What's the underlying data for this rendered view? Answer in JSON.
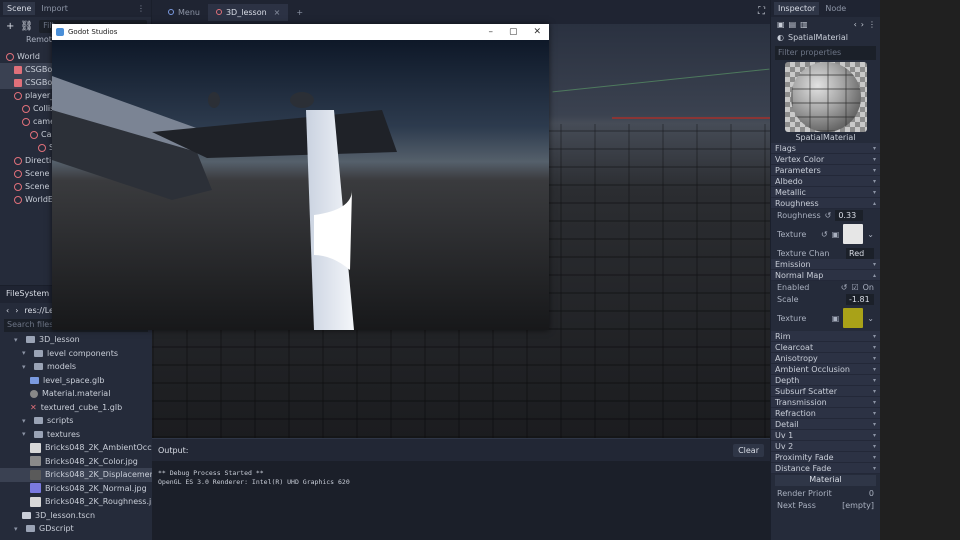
{
  "scene_dock": {
    "tabs": [
      "Scene",
      "Import"
    ],
    "filter_placeholder": "Filt",
    "remote_label": "Remote",
    "tree": [
      {
        "label": "World",
        "indent": 0
      },
      {
        "label": "CSGBox",
        "indent": 1
      },
      {
        "label": "CSGBox",
        "indent": 1
      },
      {
        "label": "player_",
        "indent": 1
      },
      {
        "label": "Collis",
        "indent": 2
      },
      {
        "label": "came",
        "indent": 2
      },
      {
        "label": "Cas",
        "indent": 3
      },
      {
        "label": "S",
        "indent": 4
      },
      {
        "label": "Directi",
        "indent": 1
      },
      {
        "label": "Scene F",
        "indent": 1
      },
      {
        "label": "Scene F",
        "indent": 1
      },
      {
        "label": "WorldE",
        "indent": 1
      }
    ]
  },
  "filesystem": {
    "title": "FileSystem",
    "path": "res://Le",
    "search_placeholder": "Search files",
    "items": [
      {
        "label": "3D_lesson",
        "type": "folder",
        "indent": 1
      },
      {
        "label": "level components",
        "type": "folder",
        "indent": 2
      },
      {
        "label": "models",
        "type": "folder",
        "indent": 2
      },
      {
        "label": "level_space.glb",
        "type": "glb",
        "indent": 3
      },
      {
        "label": "Material.material",
        "type": "material",
        "indent": 3
      },
      {
        "label": "textured_cube_1.glb",
        "type": "glb-x",
        "indent": 3
      },
      {
        "label": "scripts",
        "type": "folder",
        "indent": 2
      },
      {
        "label": "textures",
        "type": "folder",
        "indent": 2
      },
      {
        "label": "Bricks048_2K_AmbientOccl",
        "type": "tex-white",
        "indent": 3
      },
      {
        "label": "Bricks048_2K_Color.jpg",
        "type": "tex-gray",
        "indent": 3
      },
      {
        "label": "Bricks048_2K_Displacemen",
        "type": "tex-dark",
        "indent": 3
      },
      {
        "label": "Bricks048_2K_Normal.jpg",
        "type": "tex-blue",
        "indent": 3
      },
      {
        "label": "Bricks048_2K_Roughness.jp",
        "type": "tex-white",
        "indent": 3
      },
      {
        "label": "3D_lesson.tscn",
        "type": "scene",
        "indent": 2
      },
      {
        "label": "GDscript",
        "type": "folder",
        "indent": 1
      }
    ]
  },
  "top_tabs": [
    {
      "label": "Menu",
      "active": false
    },
    {
      "label": "3D_lesson",
      "active": true
    }
  ],
  "game_window": {
    "title": "Godot Studios"
  },
  "output": {
    "title": "Output:",
    "clear_label": "Clear",
    "lines": [
      "** Debug Process Started **",
      "OpenGL ES 3.0 Renderer: Intel(R) UHD Graphics 620"
    ]
  },
  "inspector": {
    "tabs": [
      "Inspector",
      "Node"
    ],
    "object_name": "SpatialMaterial",
    "filter_placeholder": "Filter properties",
    "preview_label": "SpatialMaterial",
    "sections_top": [
      "Flags",
      "Vertex Color",
      "Parameters",
      "Albedo",
      "Metallic",
      "Roughness"
    ],
    "roughness_label": "Roughness",
    "roughness_value": "0.33",
    "texture_label": "Texture",
    "texture_channel_label": "Texture Chan",
    "texture_channel_value": "Red",
    "emission_label": "Emission",
    "normal_map_label": "Normal Map",
    "enabled_label": "Enabled",
    "enabled_value": "On",
    "scale_label": "Scale",
    "scale_value": "-1.81",
    "texture2_label": "Texture",
    "sections_bottom": [
      "Rim",
      "Clearcoat",
      "Anisotropy",
      "Ambient Occlusion",
      "Depth",
      "Subsurf Scatter",
      "Transmission",
      "Refraction",
      "Detail",
      "Uv 1",
      "Uv 2",
      "Proximity Fade",
      "Distance Fade"
    ],
    "material_label": "Material",
    "render_priority_label": "Render Priorit",
    "render_priority_value": "0",
    "next_pass_label": "Next Pass",
    "next_pass_value": "[empty]"
  }
}
